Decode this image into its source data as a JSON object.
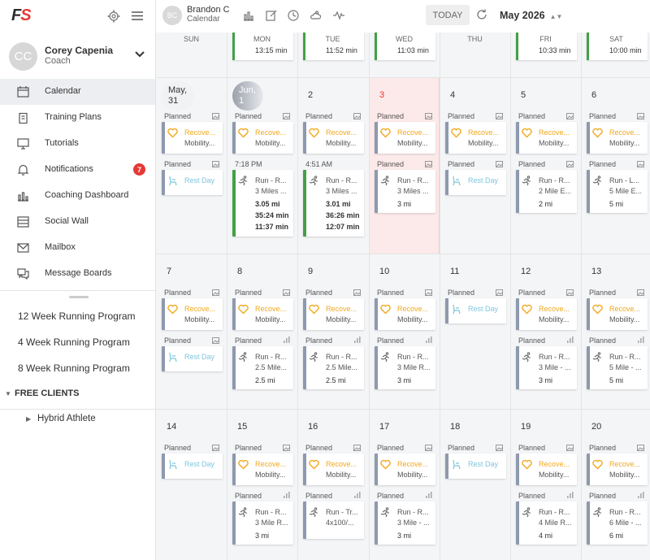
{
  "app": {
    "logo_f": "F",
    "logo_s": "S"
  },
  "profile": {
    "initials": "CC",
    "name": "Corey Capenia",
    "role": "Coach"
  },
  "nav": [
    {
      "label": "Calendar",
      "icon": "calendar-icon",
      "active": true
    },
    {
      "label": "Training Plans",
      "icon": "clipboard-icon"
    },
    {
      "label": "Tutorials",
      "icon": "monitor-icon"
    },
    {
      "label": "Notifications",
      "icon": "bell-icon",
      "badge": "7"
    },
    {
      "label": "Coaching Dashboard",
      "icon": "bar-chart-icon"
    },
    {
      "label": "Social Wall",
      "icon": "wall-icon"
    },
    {
      "label": "Mailbox",
      "icon": "mail-icon"
    },
    {
      "label": "Message Boards",
      "icon": "chat-icon"
    }
  ],
  "programs": [
    "12 Week Running Program",
    "4 Week Running Program",
    "8 Week Running Program"
  ],
  "free_clients": "FREE CLIENTS",
  "client_group": "Hybrid Athlete",
  "header": {
    "initials": "BC",
    "name": "Brandon C",
    "subtitle": "Calendar",
    "today": "TODAY",
    "month": "May 2026"
  },
  "days": [
    "SUN",
    "MON",
    "TUE",
    "WED",
    "THU",
    "FRI",
    "SAT"
  ],
  "top_partial": [
    "",
    "13:15 min",
    "11:52 min",
    "11:03 min",
    "",
    "10:33 min",
    "10:00 min"
  ],
  "strings": {
    "planned": "Planned",
    "recovery": "Recove...",
    "mobility": "Mobility...",
    "rest": "Rest Day"
  },
  "weeks": [
    {
      "dates": [
        "May, 31",
        "Jun, 1",
        "2",
        "3",
        "4",
        "5",
        "6"
      ],
      "second": [
        {
          "type": "rest"
        },
        {
          "type": "run",
          "time": "7:18 PM",
          "t1": "Run - R...",
          "t2": "3 Miles ...",
          "m": [
            "3.05 mi",
            "35:24 min",
            "11:37 min"
          ],
          "green": true
        },
        {
          "type": "run",
          "time": "4:51 AM",
          "t1": "Run - R...",
          "t2": "3 Miles ...",
          "m": [
            "3.01 mi",
            "36:26 min",
            "12:07 min"
          ],
          "green": true
        },
        {
          "type": "run",
          "t1": "Run - R...",
          "t2": "3 Miles ...",
          "m": [
            "3 mi"
          ]
        },
        {
          "type": "rest"
        },
        {
          "type": "run",
          "t1": "Run - R...",
          "t2": "2 Mile E...",
          "m": [
            "2 mi"
          ]
        },
        {
          "type": "run",
          "t1": "Run - L...",
          "t2": "5 Mile E...",
          "m": [
            "5 mi"
          ]
        }
      ]
    },
    {
      "dates": [
        "7",
        "8",
        "9",
        "10",
        "11",
        "12",
        "13"
      ],
      "second": [
        {
          "type": "rest"
        },
        {
          "type": "run",
          "t1": "Run - R...",
          "t2": "2.5 Mile...",
          "m": [
            "2.5 mi"
          ]
        },
        {
          "type": "run",
          "t1": "Run - R...",
          "t2": "2.5 Mile...",
          "m": [
            "2.5 mi"
          ]
        },
        {
          "type": "run",
          "t1": "Run - R...",
          "t2": "3 Mile R...",
          "m": [
            "3 mi"
          ]
        },
        null,
        {
          "type": "run",
          "t1": "Run - R...",
          "t2": "3 Mile - ...",
          "m": [
            "3 mi"
          ]
        },
        {
          "type": "run",
          "t1": "Run - R...",
          "t2": "5 Mile - ...",
          "m": [
            "5 mi"
          ]
        }
      ]
    },
    {
      "dates": [
        "14",
        "15",
        "16",
        "17",
        "18",
        "19",
        "20"
      ],
      "second": [
        null,
        {
          "type": "run",
          "t1": "Run - R...",
          "t2": "3 Mile R...",
          "m": [
            "3 mi"
          ]
        },
        {
          "type": "run",
          "t1": "Run - Tr...",
          "t2": "4x100/...",
          "m": []
        },
        {
          "type": "run",
          "t1": "Run - R...",
          "t2": "3 Mile - ...",
          "m": [
            "3 mi"
          ]
        },
        null,
        {
          "type": "run",
          "t1": "Run - R...",
          "t2": "4 Mile R...",
          "m": [
            "4 mi"
          ]
        },
        {
          "type": "run",
          "t1": "Run - R...",
          "t2": "6 Mile - ...",
          "m": [
            "6 mi"
          ]
        }
      ]
    }
  ]
}
